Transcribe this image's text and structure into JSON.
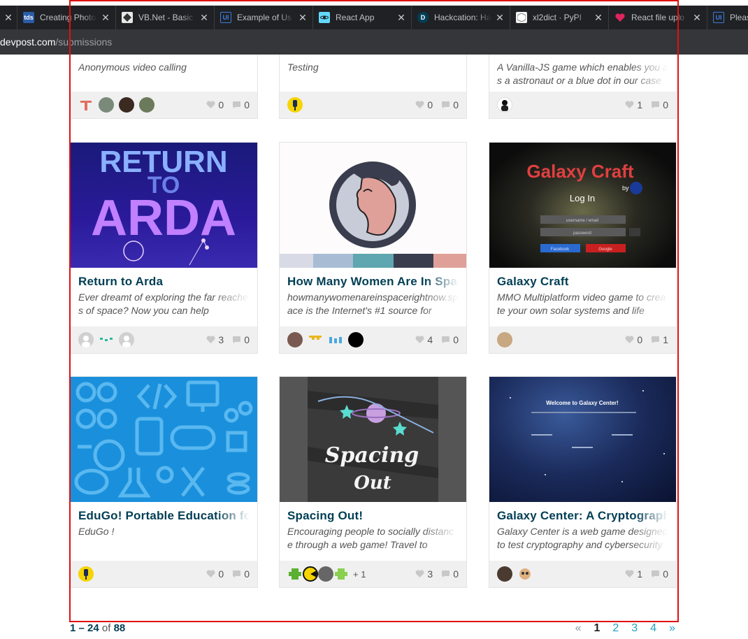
{
  "browser": {
    "tabs": [
      {
        "title": "Creating Photo",
        "favicon_text": "tds",
        "favicon_color": "#2a5caa"
      },
      {
        "title": "VB.Net - Basic",
        "favicon_text": "",
        "favicon_color": "#e8e8e8"
      },
      {
        "title": "Example of Us",
        "favicon_text": "UI",
        "favicon_color": "#1e6bd6"
      },
      {
        "title": "React App",
        "favicon_text": "",
        "favicon_color": "#61dafb"
      },
      {
        "title": "Hackcation: Ha",
        "favicon_text": "D",
        "favicon_color": "#003e54"
      },
      {
        "title": "xl2dict · PyPI",
        "favicon_text": "",
        "favicon_color": "#f2f2f2"
      },
      {
        "title": "React file uplo",
        "favicon_text": "",
        "favicon_color": "#e0245e"
      },
      {
        "title": "Pleas",
        "favicon_text": "UI",
        "favicon_color": "#1e6bd6"
      }
    ],
    "address_host": "devpost.com",
    "address_path": "/submissions"
  },
  "cards": [
    {
      "name": "",
      "tagline": "Anonymous video calling",
      "likes": "0",
      "comments": "0"
    },
    {
      "name": "",
      "tagline": "Testing",
      "likes": "0",
      "comments": "0"
    },
    {
      "name": "",
      "tagline": "A Vanilla-JS game which enables you as a astronaut or a blue dot in our case",
      "likes": "1",
      "comments": "0"
    },
    {
      "name": "Return to Arda",
      "tagline": "Ever dreamt of exploring the far reaches of space? Now you can help",
      "likes": "3",
      "comments": "0",
      "thumb_text_1": "RETURN",
      "thumb_text_2": "TO",
      "thumb_text_3": "ARDA"
    },
    {
      "name": "How Many Women Are In Space",
      "tagline": "howmanywomenareinspacerightnow.space is the Internet's #1 source for",
      "likes": "4",
      "comments": "0"
    },
    {
      "name": "Galaxy Craft",
      "tagline": "MMO Multiplatform video game to create your own solar systems and life",
      "likes": "0",
      "comments": "1",
      "thumb_title": "Galaxy Craft",
      "thumb_by": "by",
      "thumb_login": "Log In",
      "thumb_user": "username / email",
      "thumb_pass": "password",
      "thumb_fb": "Facebook",
      "thumb_google": "Google"
    },
    {
      "name": "EduGo! Portable Education for",
      "tagline": "EduGo !",
      "likes": "0",
      "comments": "0"
    },
    {
      "name": "Spacing Out!",
      "tagline": "Encouraging people to socially distance through a web game! Travel to",
      "likes": "3",
      "comments": "0",
      "extra_members": "+ 1",
      "thumb_line_1": "Spacing",
      "thumb_line_2": "Out"
    },
    {
      "name": "Galaxy Center: A Cryptography",
      "tagline": "Galaxy Center is a web game designed to test cryptography and cybersecurity",
      "likes": "1",
      "comments": "0",
      "thumb_heading": "Welcome to Galaxy Center!"
    }
  ],
  "pagination": {
    "range": "1 – 24",
    "of": "of",
    "total": "88",
    "prev": "«",
    "pages": [
      "1",
      "2",
      "3",
      "4"
    ],
    "next": "»"
  },
  "colors": {
    "title": "#003e54",
    "link": "#1fa1c2",
    "highlight": "#e01010"
  }
}
